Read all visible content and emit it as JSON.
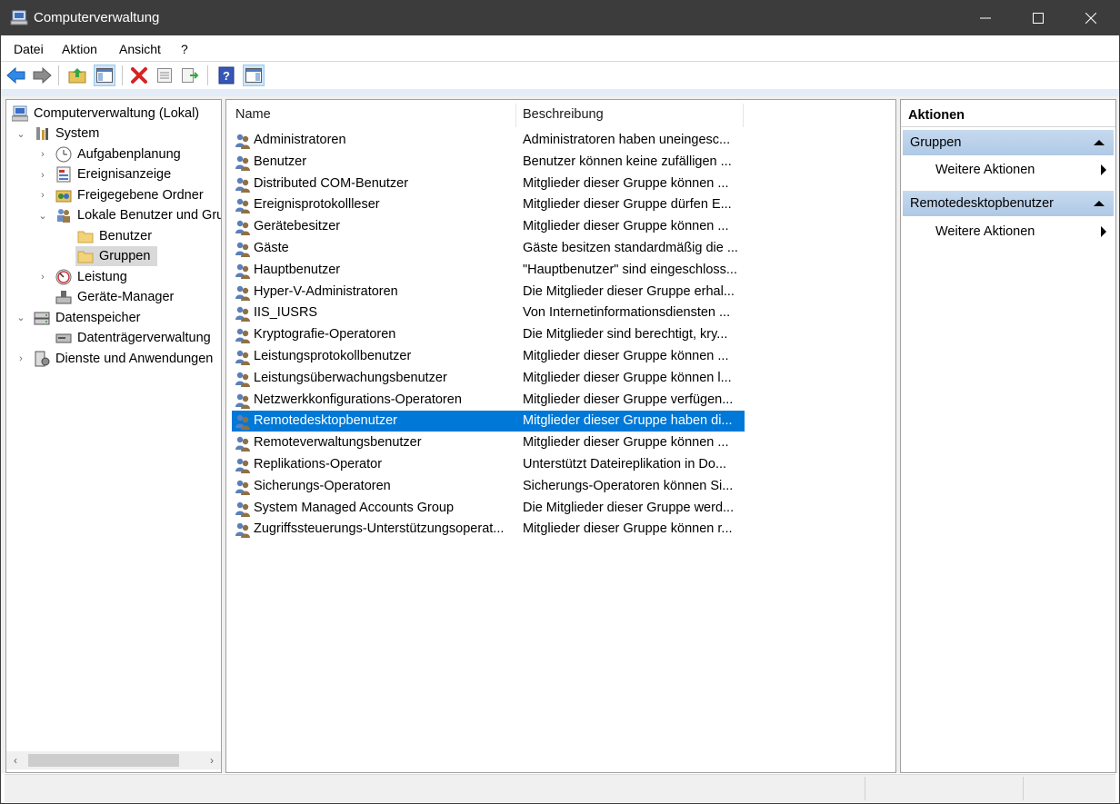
{
  "window": {
    "title": "Computerverwaltung"
  },
  "menu": [
    "Datei",
    "Aktion",
    "Ansicht",
    "?"
  ],
  "toolbar": [
    "back-icon",
    "forward-icon",
    "up-folder-icon",
    "show-hide-tree-icon",
    "delete-icon",
    "properties-icon",
    "export-list-icon",
    "help-icon",
    "show-hide-action-pane-icon"
  ],
  "tree": {
    "root": "Computerverwaltung (Lokal)",
    "system": "System",
    "aufgabenplanung": "Aufgabenplanung",
    "ereignisanzeige": "Ereignisanzeige",
    "freigegebene": "Freigegebene Ordner",
    "lokale": "Lokale Benutzer und Gruppen",
    "benutzer": "Benutzer",
    "gruppen": "Gruppen",
    "leistung": "Leistung",
    "geraete": "Geräte-Manager",
    "datenspeicher": "Datenspeicher",
    "datentraeger": "Datenträgerverwaltung",
    "dienste": "Dienste und Anwendungen"
  },
  "list": {
    "col_name": "Name",
    "col_desc": "Beschreibung",
    "selected_index": 13,
    "rows": [
      {
        "name": "Administratoren",
        "desc": "Administratoren haben uneingesc..."
      },
      {
        "name": "Benutzer",
        "desc": "Benutzer können keine zufälligen ..."
      },
      {
        "name": "Distributed COM-Benutzer",
        "desc": "Mitglieder dieser Gruppe können ..."
      },
      {
        "name": "Ereignisprotokollleser",
        "desc": "Mitglieder dieser Gruppe dürfen E..."
      },
      {
        "name": "Gerätebesitzer",
        "desc": "Mitglieder dieser Gruppe können ..."
      },
      {
        "name": "Gäste",
        "desc": "Gäste besitzen standardmäßig die ..."
      },
      {
        "name": "Hauptbenutzer",
        "desc": "\"Hauptbenutzer\" sind eingeschloss..."
      },
      {
        "name": "Hyper-V-Administratoren",
        "desc": "Die Mitglieder dieser Gruppe erhal..."
      },
      {
        "name": "IIS_IUSRS",
        "desc": "Von Internetinformationsdiensten ..."
      },
      {
        "name": "Kryptografie-Operatoren",
        "desc": "Die Mitglieder sind berechtigt, kry..."
      },
      {
        "name": "Leistungsprotokollbenutzer",
        "desc": "Mitglieder dieser Gruppe können ..."
      },
      {
        "name": "Leistungsüberwachungsbenutzer",
        "desc": "Mitglieder dieser Gruppe können l..."
      },
      {
        "name": "Netzwerkkonfigurations-Operatoren",
        "desc": "Mitglieder dieser Gruppe verfügen..."
      },
      {
        "name": "Remotedesktopbenutzer",
        "desc": "Mitglieder dieser Gruppe haben di..."
      },
      {
        "name": "Remoteverwaltungsbenutzer",
        "desc": "Mitglieder dieser Gruppe können ..."
      },
      {
        "name": "Replikations-Operator",
        "desc": "Unterstützt Dateireplikation in Do..."
      },
      {
        "name": "Sicherungs-Operatoren",
        "desc": "Sicherungs-Operatoren können Si..."
      },
      {
        "name": "System Managed Accounts Group",
        "desc": "Die Mitglieder dieser Gruppe werd..."
      },
      {
        "name": "Zugriffssteuerungs-Unterstützungsoperat...",
        "desc": "Mitglieder dieser Gruppe können r..."
      }
    ]
  },
  "actions": {
    "header": "Aktionen",
    "group1": "Gruppen",
    "group1_item": "Weitere Aktionen",
    "group2": "Remotedesktopbenutzer",
    "group2_item": "Weitere Aktionen"
  }
}
